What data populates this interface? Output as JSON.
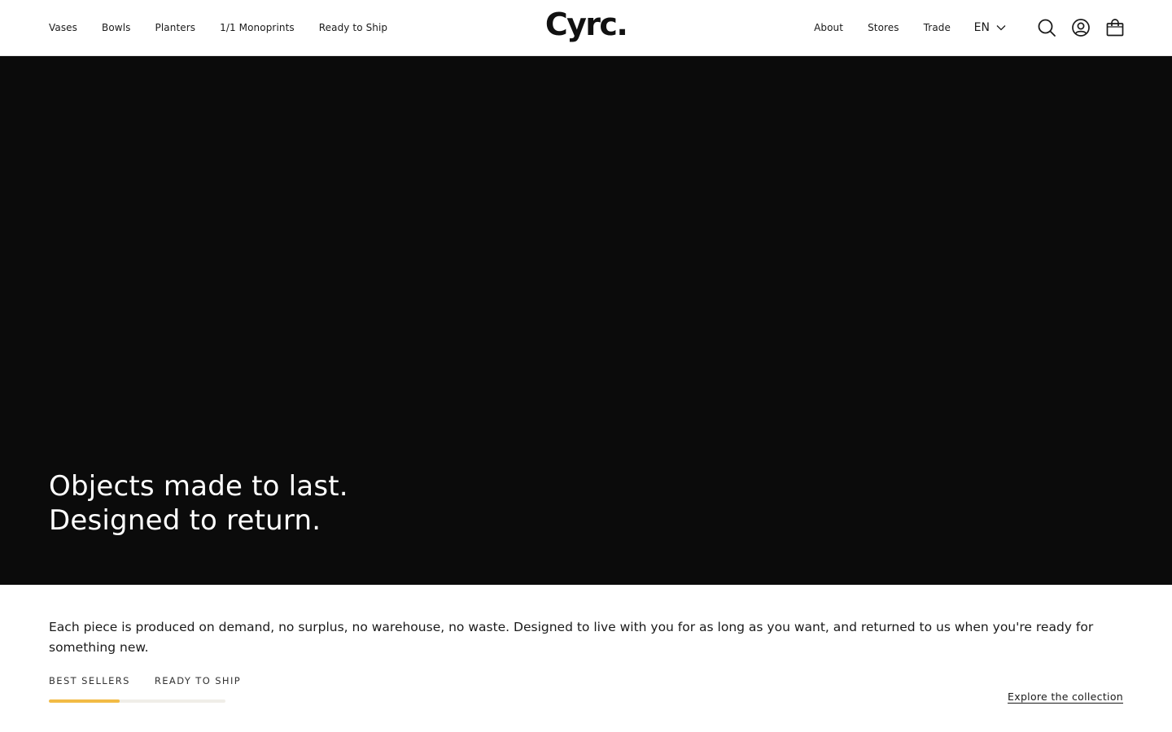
{
  "header": {
    "logo": "Cyrc.",
    "nav_left": [
      {
        "label": "Vases"
      },
      {
        "label": "Bowls"
      },
      {
        "label": "Planters"
      },
      {
        "label": "1/1 Monoprints"
      },
      {
        "label": "Ready to Ship"
      }
    ],
    "nav_right": [
      {
        "label": "About"
      },
      {
        "label": "Stores"
      },
      {
        "label": "Trade"
      }
    ],
    "language": "EN",
    "icons": [
      "chevron-down-icon",
      "search-icon",
      "account-icon",
      "bag-icon"
    ]
  },
  "hero": {
    "title_line1": "Objects made to last.",
    "title_line2": "Designed to return.",
    "background_color": "#0b0b0b"
  },
  "intro": {
    "text": "Each piece is produced on demand, no surplus, no warehouse, no waste. Designed to live with you for as long as you want, and returned to us when you're ready for something new."
  },
  "collection": {
    "tabs": [
      {
        "label": "BEST SELLERS",
        "active": true
      },
      {
        "label": "READY TO SHIP",
        "active": false
      }
    ],
    "progress_fraction": 0.4,
    "progress_color": "#f2bb45",
    "explore_label": "Explore the collection"
  }
}
